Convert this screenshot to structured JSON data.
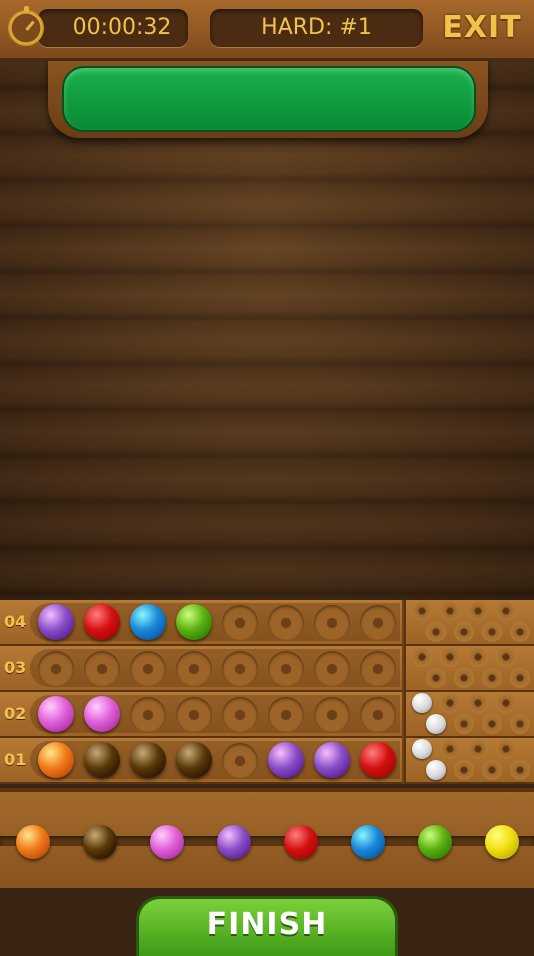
{
  "header": {
    "timer": "00:00:32",
    "level": "HARD: #1",
    "exit_label": "EXIT"
  },
  "board": {
    "rows": [
      {
        "label": "04",
        "pegs": [
          "purple",
          "red",
          "blue",
          "green",
          null,
          null,
          null,
          null
        ],
        "feedback": {
          "white": 0,
          "black": 0
        }
      },
      {
        "label": "03",
        "pegs": [
          null,
          null,
          null,
          null,
          null,
          null,
          null,
          null
        ],
        "feedback": {
          "white": 0,
          "black": 0
        }
      },
      {
        "label": "02",
        "pegs": [
          "pink",
          "pink",
          null,
          null,
          null,
          null,
          null,
          null
        ],
        "feedback": {
          "white": 2,
          "black": 0
        }
      },
      {
        "label": "01",
        "pegs": [
          "orange",
          "brown",
          "brown",
          "brown",
          null,
          "purple",
          "purple",
          "red"
        ],
        "feedback": {
          "white": 2,
          "black": 0
        }
      }
    ]
  },
  "palette": [
    "orange",
    "brown",
    "pink",
    "purple",
    "red",
    "blue",
    "green",
    "yellow"
  ],
  "finish_label": "FINISH",
  "colors": {
    "orange": "#f07a1a",
    "brown": "#5a3a08",
    "pink": "#e060d8",
    "purple": "#8a4fc8",
    "red": "#d41010",
    "blue": "#1a88d8",
    "green": "#5cb010",
    "yellow": "#f0e010",
    "secret_bar": "#12a040"
  }
}
